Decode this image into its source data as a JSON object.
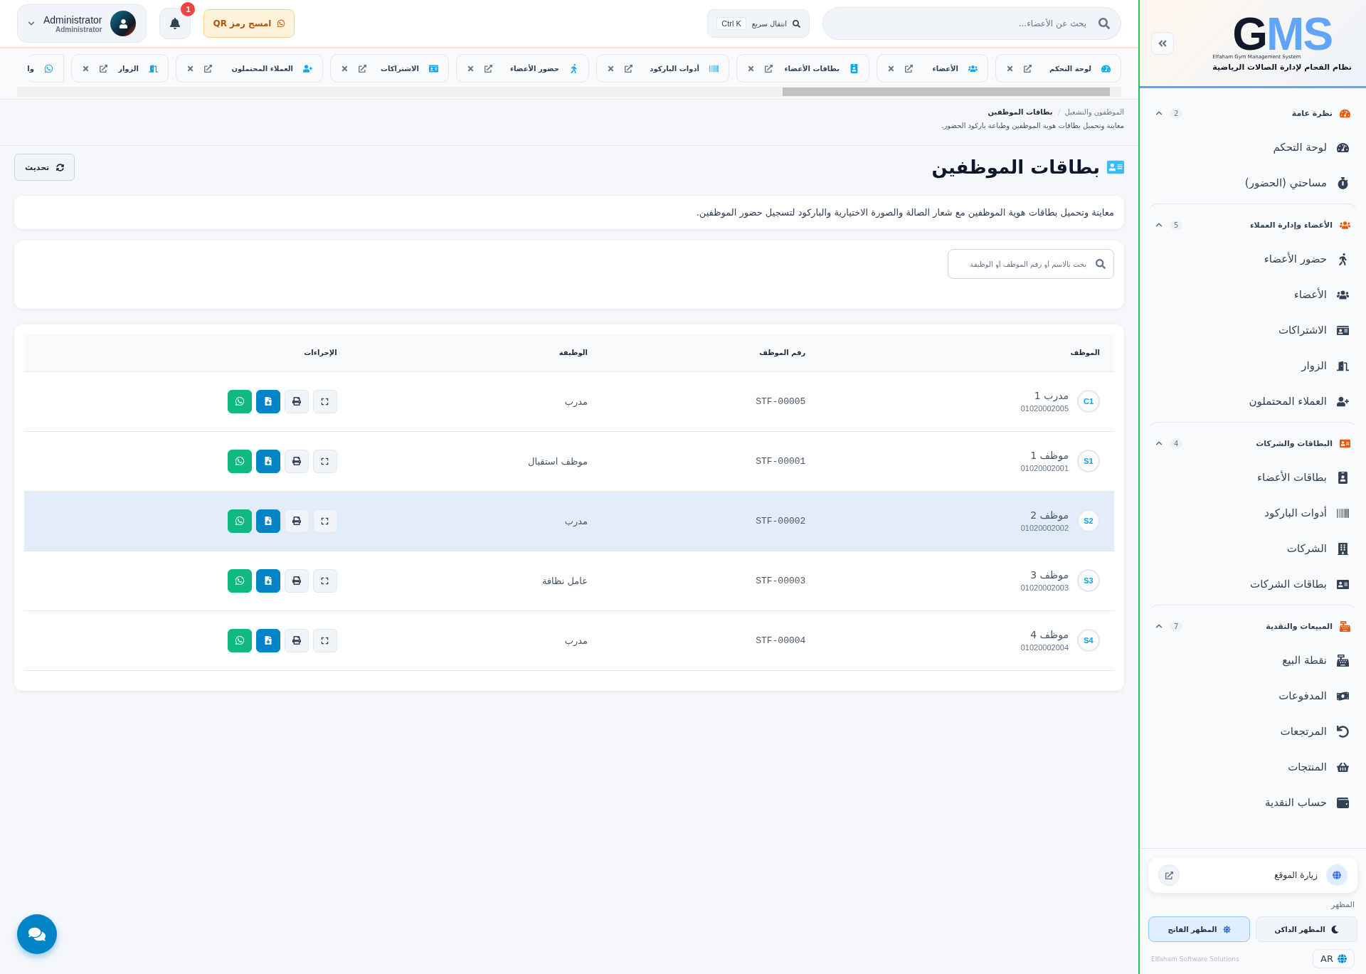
{
  "header": {
    "search": {
      "placeholder": "بحث عن الأعضاء..."
    },
    "quick_nav": {
      "label": "انتقال سريع",
      "shortcut": "Ctrl K"
    },
    "qr_button": "امسح رمز QR",
    "notifications": {
      "count": "1"
    },
    "user": {
      "name": "Administrator",
      "role": "Administrator"
    }
  },
  "tabs": [
    {
      "label": "لوحة التحكم",
      "kind": "full"
    },
    {
      "label": "الأعضاء",
      "kind": "full"
    },
    {
      "label": "بطاقات الأعضاء",
      "kind": "full"
    },
    {
      "label": "أدوات الباركود",
      "kind": "full"
    },
    {
      "label": "حضور الأعضاء",
      "kind": "full"
    },
    {
      "label": "الاشتراكات",
      "kind": "full"
    },
    {
      "label": "العملاء المحتملون",
      "kind": "full"
    },
    {
      "label": "الزوار",
      "kind": "full"
    },
    {
      "label": "وا",
      "kind": "clipped"
    }
  ],
  "breadcrumb": {
    "items": [
      "الموظفون والتشغيل",
      "بطاقات الموظفين"
    ],
    "subtitle": "معاينة وتحميل بطاقات هوية الموظفين وطباعة باركود الحضور."
  },
  "page": {
    "title": "بطاقات الموظفين",
    "refresh": "تحديث",
    "description": "معاينة وتحميل بطاقات هوية الموظفين مع شعار الصالة والصورة الاختيارية والباركود لتسجيل حضور الموظفين.",
    "search_placeholder": "بحث بالاسم أو رقم الموظف أو الوظيفة"
  },
  "table": {
    "columns": [
      "الموظف",
      "رقم الموظف",
      "الوظيفة",
      "الإجراءات"
    ],
    "rows": [
      {
        "initials": "C1",
        "name": "مدرب 1",
        "phone": "01020002005",
        "id": "STF-00005",
        "job": "مدرب",
        "selected": false
      },
      {
        "initials": "S1",
        "name": "موظف 1",
        "phone": "01020002001",
        "id": "STF-00001",
        "job": "موظف استقبال",
        "selected": false
      },
      {
        "initials": "S2",
        "name": "موظف 2",
        "phone": "01020002002",
        "id": "STF-00002",
        "job": "مدرب",
        "selected": true
      },
      {
        "initials": "S3",
        "name": "موظف 3",
        "phone": "01020002003",
        "id": "STF-00003",
        "job": "عامل نظافة",
        "selected": false
      },
      {
        "initials": "S4",
        "name": "موظف 4",
        "phone": "01020002004",
        "id": "STF-00004",
        "job": "مدرب",
        "selected": false
      }
    ]
  },
  "sidebar": {
    "logo": {
      "initial": "G",
      "rest": "MS",
      "subtitle": "Elfaham Gym Management System",
      "tagline": "نظام الفحام لإدارة الصالات الرياضية"
    },
    "groups": [
      {
        "title": "نظرة عامة",
        "count": "2",
        "expanded": true,
        "items": [
          "لوحة التحكم",
          "مساحتي (الحضور)"
        ]
      },
      {
        "title": "الأعضاء وإدارة العملاء",
        "count": "5",
        "expanded": true,
        "items": [
          "حضور الأعضاء",
          "الأعضاء",
          "الاشتراكات",
          "الزوار",
          "العملاء المحتملون"
        ]
      },
      {
        "title": "البطاقات والشركات",
        "count": "4",
        "expanded": true,
        "items": [
          "بطاقات الأعضاء",
          "أدوات الباركود",
          "الشركات",
          "بطاقات الشركات"
        ]
      },
      {
        "title": "المبيعات والنقدية",
        "count": "7",
        "expanded": true,
        "items": [
          "نقطة البيع",
          "المدفوعات",
          "المرتجعات",
          "المنتجات",
          "حساب النقدية"
        ]
      }
    ],
    "visit_site": "زيارة الموقع",
    "appearance_label": "المظهر",
    "themes": [
      {
        "label": "المظهر الداكن",
        "kind": "dark",
        "selected": false
      },
      {
        "label": "المظهر الفاتح",
        "kind": "light",
        "selected": true
      }
    ],
    "language": "AR",
    "footer": "Elfaham Software Solutions"
  }
}
